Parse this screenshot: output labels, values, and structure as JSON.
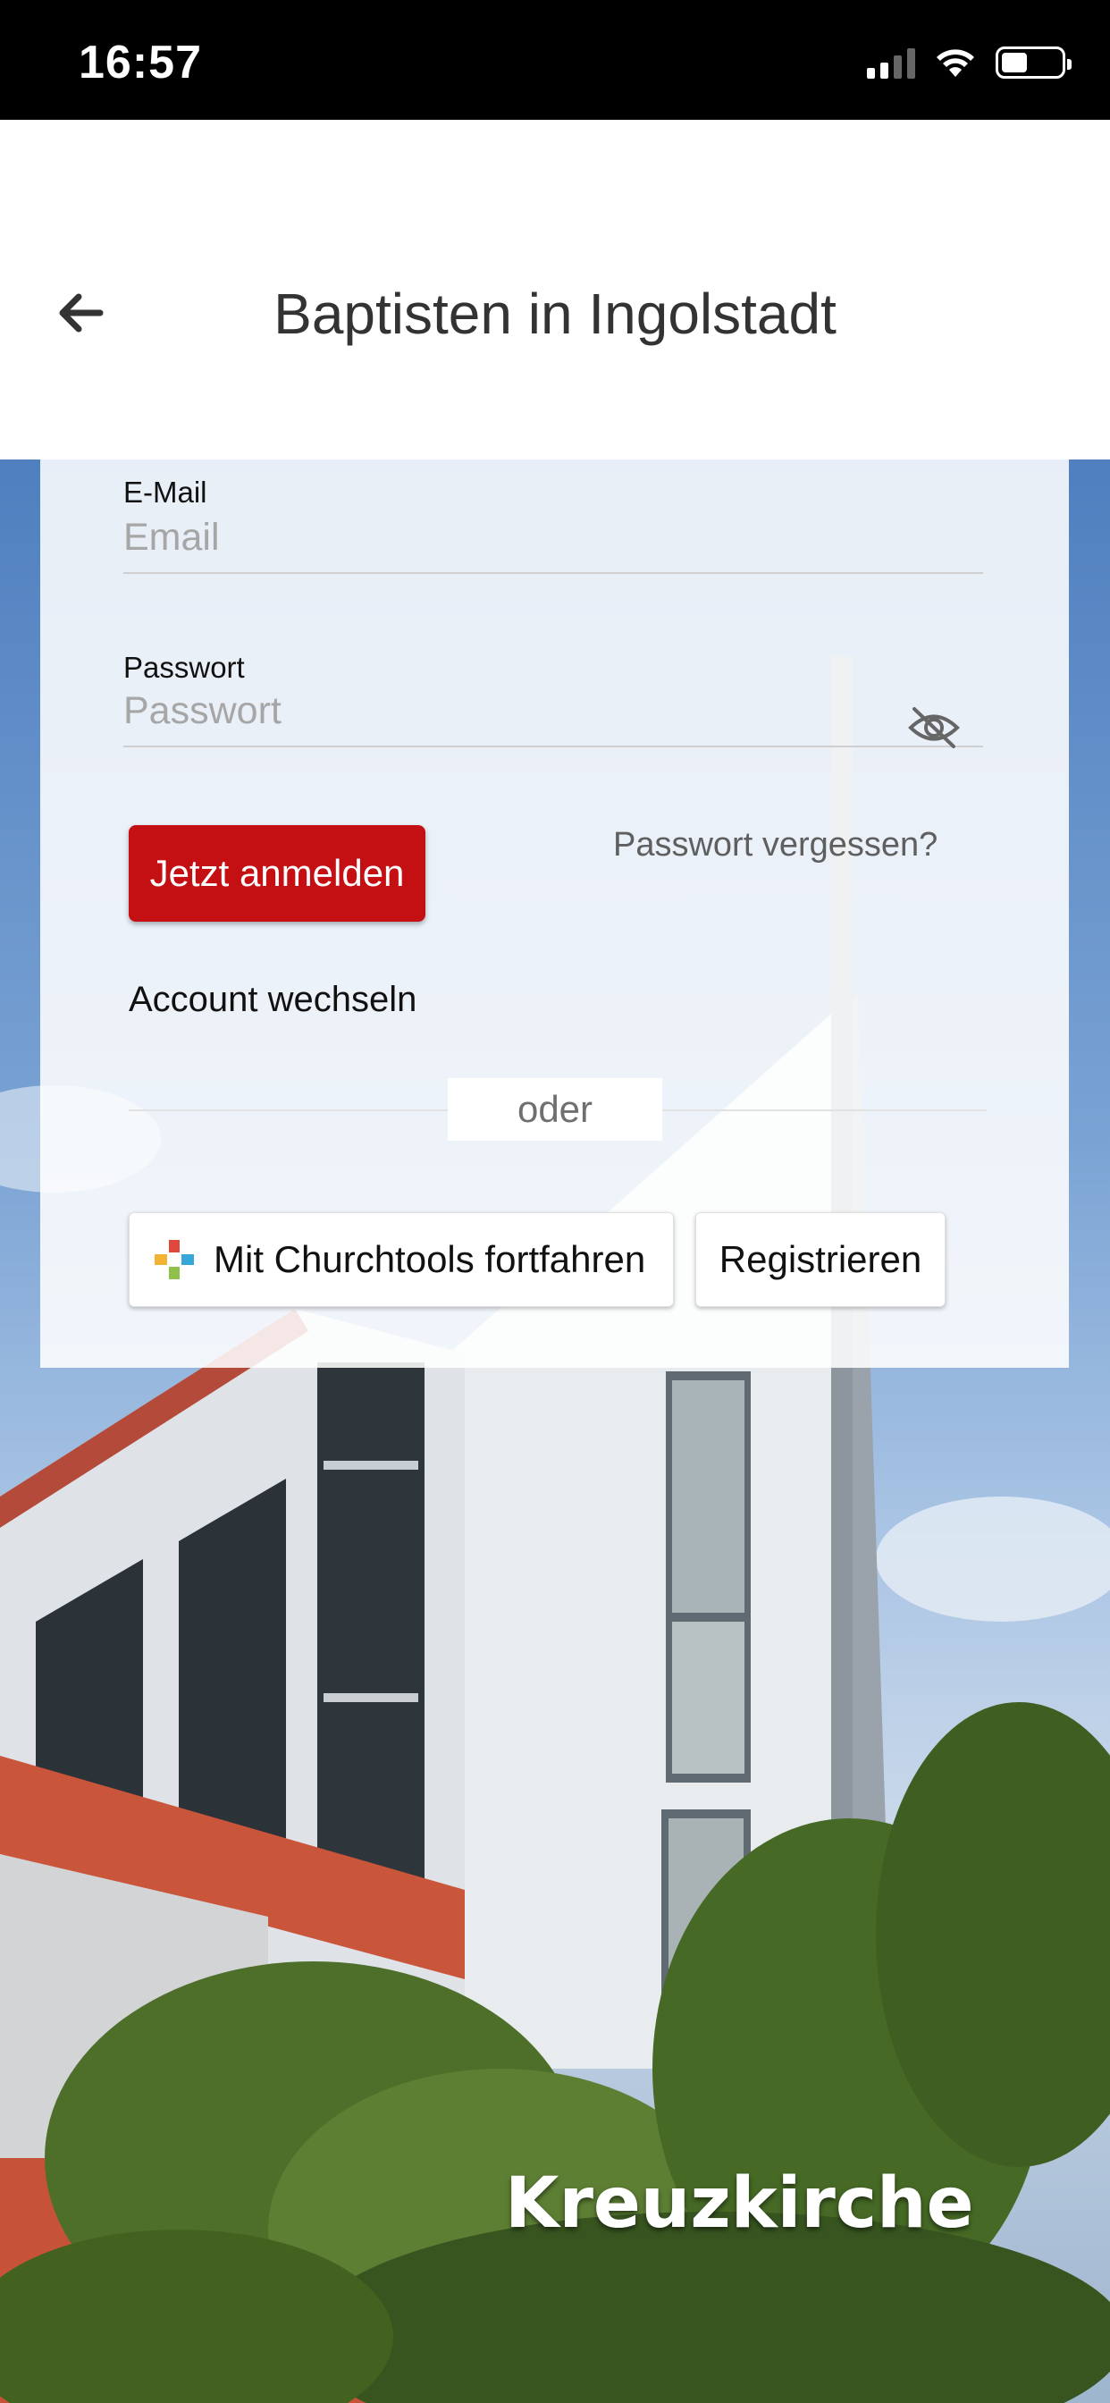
{
  "status_bar": {
    "time": "16:57",
    "signal_icon": "cellular-signal-icon",
    "wifi_icon": "wifi-icon",
    "battery_icon": "battery-icon"
  },
  "header": {
    "title": "Baptisten in Ingolstadt",
    "back_icon": "arrow-left-icon"
  },
  "login_form": {
    "email_label": "E-Mail",
    "email_placeholder": "Email",
    "email_value": "",
    "password_label": "Passwort",
    "password_placeholder": "Passwort",
    "password_value": "",
    "password_toggle_icon": "eye-off-icon",
    "login_button": "Jetzt anmelden",
    "forgot_password": "Passwort vergessen?",
    "switch_account": "Account wechseln",
    "divider": "oder",
    "churchtools_button": "Mit Churchtools fortfahren",
    "churchtools_icon": "churchtools-logo-icon",
    "register_button": "Registrieren"
  },
  "hero": {
    "caption": "Kreuzkirche"
  },
  "colors": {
    "primary": "#c40f13",
    "header_bg": "#ffffff",
    "status_bg": "#000000"
  }
}
